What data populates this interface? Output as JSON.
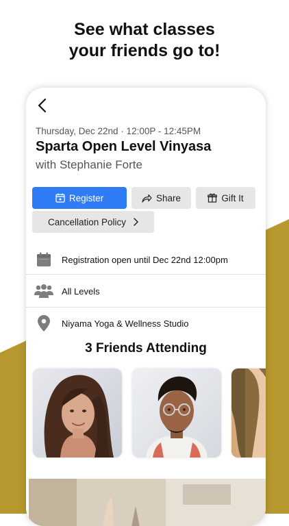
{
  "headline": {
    "line1": "See what classes",
    "line2": "your friends go to!"
  },
  "colors": {
    "gold": "#b7982e",
    "primary": "#2f7cf6"
  },
  "detail": {
    "date": "Thursday, Dec 22nd · 12:00P - 12:45PM",
    "title": "Sparta Open Level Vinyasa",
    "instructor": "with Stephanie Forte"
  },
  "actions": {
    "register": "Register",
    "share": "Share",
    "gift": "Gift It",
    "cancellation": "Cancellation Policy"
  },
  "info": {
    "registration": "Registration open until Dec 22nd 12:00pm",
    "levels": "All Levels",
    "studio": "Niyama Yoga & Wellness Studio"
  },
  "friends": {
    "heading": "3 Friends Attending"
  }
}
